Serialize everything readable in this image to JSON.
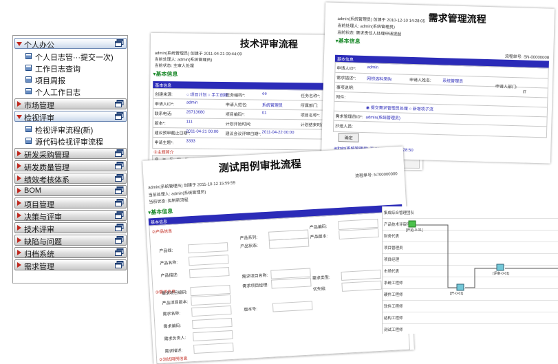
{
  "menu": {
    "categories": [
      {
        "label": "个人办公",
        "open": true,
        "items": [
          "个人日志管···提交一次)",
          "工作日志查询",
          "项目周报",
          "个人工作日志"
        ]
      },
      {
        "label": "市场管理",
        "open": false,
        "items": []
      },
      {
        "label": "检视评审",
        "open": true,
        "items": [
          "检视评审流程(新)",
          "源代码检视评审流程"
        ]
      },
      {
        "label": "研发采购管理",
        "open": false,
        "items": []
      },
      {
        "label": "研发质量管理",
        "open": false,
        "items": []
      },
      {
        "label": "绩效考核体系",
        "open": false,
        "items": []
      },
      {
        "label": "BOM",
        "open": false,
        "items": []
      },
      {
        "label": "项目管理",
        "open": false,
        "items": []
      },
      {
        "label": "决策与评审",
        "open": false,
        "items": []
      },
      {
        "label": "技术评审",
        "open": false,
        "items": []
      },
      {
        "label": "缺陷与问题",
        "open": false,
        "items": []
      },
      {
        "label": "归档系统",
        "open": false,
        "items": []
      },
      {
        "label": "需求管理",
        "open": false,
        "items": []
      }
    ]
  },
  "doc_tech": {
    "title": "技术评审流程",
    "meta1": "admin(系统管理员) 创建于 2011-04-21 09:44:09",
    "meta2": "当前处理人: admin(系统管理员)",
    "meta3": "当前状态: 主审人处理",
    "section": "基本信息",
    "bar": "基本信息",
    "rows": [
      [
        "创建来源:",
        "○ 项目计划 ○ 手工创建",
        "任务编码*:",
        "ee",
        "任务名称*:"
      ],
      [
        "申请人ID*:",
        "admin",
        "申请人姓名:",
        "系统管理员",
        "所属部门:"
      ],
      [
        "联系电话:",
        "26713680",
        "项目编码*:",
        "01",
        "项目名称*:"
      ],
      [
        "版本*:",
        "111",
        "计划开始时间:",
        "",
        "计划结束时间:"
      ],
      [
        "建议预审截止日期*:",
        "2011-04-21 00:00",
        "建议会议评审日期*:",
        "2011-04-22 00:00",
        ""
      ],
      [
        "申请主题*:",
        "3333",
        "",
        "",
        ""
      ]
    ],
    "body_label": "②主题简介"
  },
  "doc_req": {
    "title": "需求管理流程",
    "meta1": "admin(系统管理员) 创建于 2010-12-10 14:28:05",
    "meta2": "当前处理人: admin(系统管理员)",
    "meta3": "当前状态: 需求责任人处理申请提起",
    "section": "基本信息",
    "serial": "流程单号: SN-00000008",
    "bar": "基本信息",
    "rows": [
      [
        "申请人ID*:",
        "admin",
        "",
        ""
      ],
      [
        "需求描述*:",
        "网初选料采购",
        "申请人姓名:",
        "系统管理员"
      ],
      [
        "事项说明:",
        "",
        "",
        ""
      ],
      [
        "附件:",
        "",
        "",
        ""
      ],
      [
        "",
        "◉ 提交需求管理员处理 ○ 新增项子流",
        "",
        ""
      ],
      [
        "需求管理员ID*:",
        "admin(系统管理员)",
        "",
        ""
      ],
      [
        "抄送人员:",
        "",
        "",
        ""
      ]
    ],
    "dept_label": "申请人部门:",
    "dept_value": "IT",
    "confirm_btn": "确定",
    "footer": "admin(系统管理员) 于 2010-12-10 14:28:50"
  },
  "doc_test": {
    "title": "测试用例审批流程",
    "meta1": "admin(系统管理员) 创建于 2011-10-12 15:59:59",
    "meta2": "当前处理人: admin(系统管理员)",
    "meta3": "当前状态: 拟制新流程",
    "serial": "流程单号: N700000000",
    "section": "基本信息",
    "bar": "基本信息",
    "group1": "②产品信息",
    "group2": "②需求信息",
    "group3": "②测试用例信息",
    "fields": [
      "产品系列:",
      "产品编码:",
      "产品线:",
      "产品状态:",
      "产品版本:",
      "产品名称:",
      "产品描述:",
      "需求项目名称:",
      "需求类型:",
      "需求项目编码:",
      "需求项目经理:",
      "优先级:",
      "产品项目版本:",
      "需求名称:",
      "版本号:",
      "需求编码:",
      "需求负责人:",
      "需求描述:"
    ]
  },
  "diagram": {
    "roles": [
      "集成综合管理团队",
      "产品技术评审团队",
      "财务代表",
      "项目管理员",
      "项目经理",
      "市场代表",
      "系统工程师",
      "硬件工程师",
      "软件工程师",
      "结构工程师",
      "测试工程师"
    ],
    "node_labels": [
      "[开始-0-01]",
      "[开-0-01]",
      "[评审-0-01]"
    ]
  }
}
